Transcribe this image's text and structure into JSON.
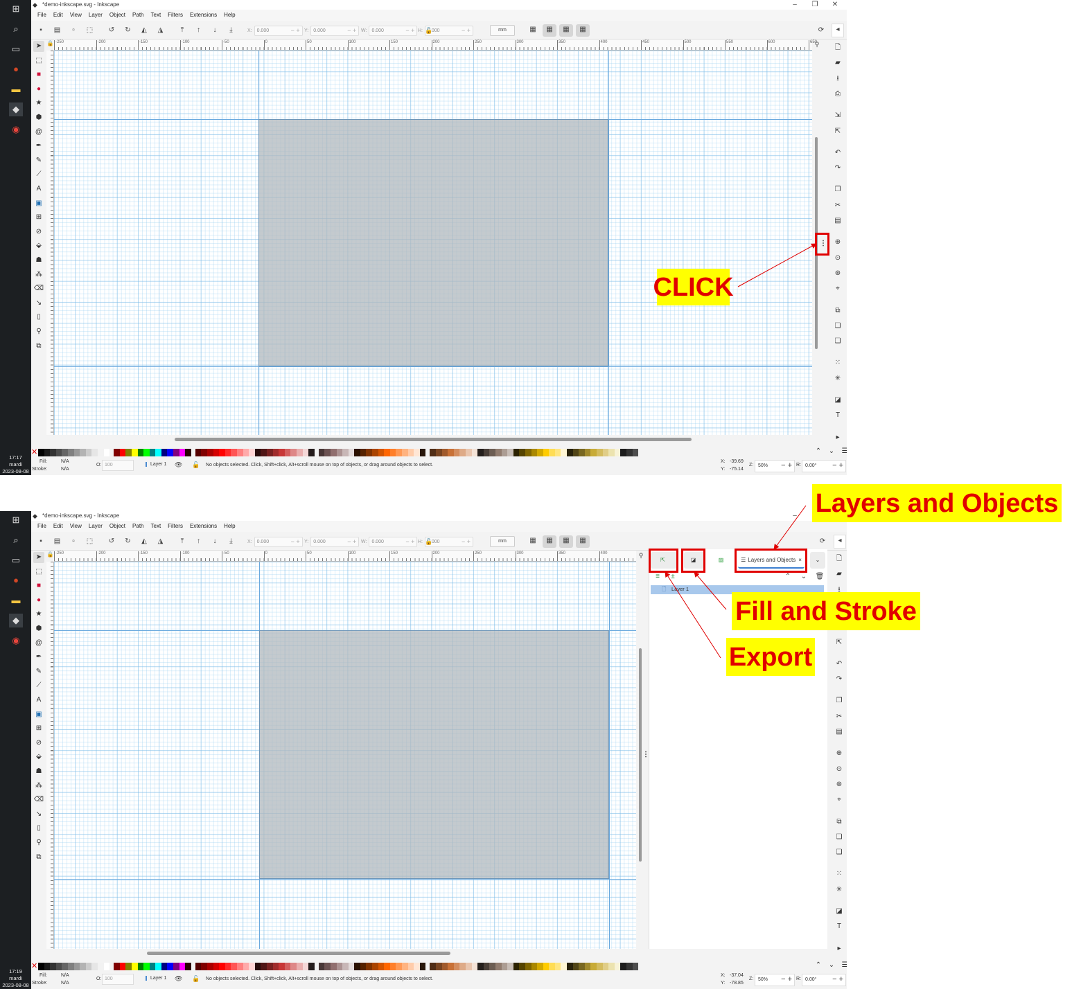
{
  "app": {
    "title": "*demo-inkscape.svg - Inkscape",
    "window_controls": [
      "–",
      "❐",
      "✕"
    ],
    "menu": [
      "File",
      "Edit",
      "View",
      "Layer",
      "Object",
      "Path",
      "Text",
      "Filters",
      "Extensions",
      "Help"
    ],
    "fields": [
      {
        "label": "X:",
        "value": "0.000"
      },
      {
        "label": "Y:",
        "value": "0.000"
      },
      {
        "label": "W:",
        "value": "0.000"
      },
      {
        "label": "H:",
        "value": "0.000"
      }
    ],
    "unit": "mm",
    "taskbar_icons": [
      "windows-icon",
      "search-icon",
      "task-view-icon",
      "powerpoint-icon",
      "file-explorer-icon",
      "inkscape-icon",
      "chrome-icon"
    ],
    "tools": [
      "selector-icon",
      "node-icon",
      "rectangle-icon",
      "ellipse-icon",
      "star-icon",
      "3d-box-icon",
      "spiral-icon",
      "pen-icon",
      "pencil-icon",
      "calligraphy-icon",
      "text-icon",
      "gradient-icon",
      "mesh-icon",
      "dropper-icon",
      "paint-bucket-icon",
      "tweak-icon",
      "spray-icon",
      "eraser-icon",
      "connector-icon",
      "pages-icon",
      "zoom-icon",
      "measure-icon"
    ],
    "commands": [
      "new-document-icon",
      "open-icon",
      "save-icon",
      "print-icon",
      "import-icon",
      "export-icon",
      "undo-icon",
      "redo-icon",
      "copy-icon",
      "cut-icon",
      "paste-icon",
      "zoom-selection-icon",
      "zoom-drawing-icon",
      "zoom-page-icon",
      "zoom-center-icon",
      "duplicate-icon",
      "clone-icon",
      "unlink-clone-icon",
      "group-icon",
      "ungroup-icon",
      "fill-stroke-icon",
      "text-font-icon",
      "more-icon"
    ],
    "palette": [
      "#000000",
      "#1a1a1a",
      "#333333",
      "#4d4d4d",
      "#666666",
      "#808080",
      "#999999",
      "#b3b3b3",
      "#cccccc",
      "#e6e6e6",
      "#f2f2f2",
      "#ffffff",
      "#800000",
      "#ff0000",
      "#808000",
      "#ffff00",
      "#008000",
      "#00ff00",
      "#008080",
      "#00ffff",
      "#000080",
      "#0000ff",
      "#800080",
      "#ff00ff",
      "#2b0000",
      "#550000",
      "#800000",
      "#aa0000",
      "#d40000",
      "#ff0000",
      "#ff2a2a",
      "#ff5555",
      "#ff8080",
      "#ffaaaa",
      "#ffd5d5",
      "#280b0b",
      "#501616",
      "#782121",
      "#a02c2c",
      "#c83737",
      "#d35f5f",
      "#de8787",
      "#e9afaf",
      "#f4d7d7",
      "#241c1c",
      "#483737",
      "#6c5353",
      "#916f6f",
      "#ac9393",
      "#c8b7b7",
      "#e3dbdb",
      "#2b1100",
      "#552200",
      "#803300",
      "#aa4400",
      "#d45500",
      "#ff6600",
      "#ff7f2a",
      "#ff9955",
      "#ffb380",
      "#ffccaa",
      "#ffe6d5",
      "#28170b",
      "#502d16",
      "#784421",
      "#a05a2c",
      "#c87137",
      "#d38d5f",
      "#deaa87",
      "#e9c6af",
      "#f4e3d7",
      "#241f1c",
      "#483e37",
      "#6c5d53",
      "#917c6f",
      "#ac9d93",
      "#c8beb7",
      "#2b2200",
      "#554400",
      "#806600",
      "#aa8800",
      "#d4aa00",
      "#ffcc00",
      "#ffdd55",
      "#ffe680",
      "#fff6d5",
      "#28220b",
      "#504416",
      "#786721",
      "#a0892c",
      "#c8ab37",
      "#d4bc5f",
      "#e0cd87",
      "#ece3af",
      "#f8f3d7",
      "#1c1c1c",
      "#333333",
      "#4d4d4d"
    ],
    "fill_label": "Fill:",
    "stroke_label": "Stroke:",
    "fill_value": "N/A",
    "stroke_value": "N/A",
    "opacity_label": "O:",
    "opacity_value": "100",
    "layer": "Layer 1",
    "status_message": "No objects selected. Click, Shift+click, Alt+scroll mouse on top of objects, or drag around objects to select.",
    "zoom_label": "Z:",
    "zoom": "50%",
    "rotation_label": "R:",
    "rotation": "0.00°",
    "x_label": "X:",
    "y_label": "Y:",
    "colors": {
      "accent": "#e00000",
      "callout_bg": "#ffff00",
      "page_fill": "#b9bfc4",
      "grid": "#9fd0f0",
      "selected_row": "#a8c8ec"
    }
  },
  "screens": [
    {
      "clock": {
        "time": "17:17",
        "day": "mardi",
        "date": "2023-08-08"
      },
      "cursor_x": "-39.69",
      "cursor_y": "-75.14",
      "ruler_labels": [
        "-250",
        "-200",
        "-150",
        "-100",
        "-50",
        "0",
        "50",
        "100",
        "150",
        "200",
        "250",
        "300",
        "350",
        "400",
        "450",
        "500",
        "550",
        "600",
        "650"
      ]
    },
    {
      "clock": {
        "time": "17:19",
        "day": "mardi",
        "date": "2023-08-08"
      },
      "cursor_x": "-37.04",
      "cursor_y": "-78.85",
      "ruler_labels": [
        "-250",
        "-200",
        "-150",
        "-100",
        "-50",
        "0",
        "50",
        "100",
        "150",
        "200",
        "250",
        "300",
        "350",
        "400"
      ],
      "panel": {
        "tabs": [
          {
            "name": "export",
            "icon": "export-icon"
          },
          {
            "name": "fill-and-stroke",
            "icon": "fill-stroke-icon"
          },
          {
            "name": "image",
            "icon": "image-icon"
          },
          {
            "name": "layers-and-objects",
            "label": "Layers and Objects",
            "icon": "layers-icon",
            "active": true
          }
        ],
        "close": "×",
        "layers": [
          "Layer 1"
        ]
      }
    }
  ],
  "annotations": {
    "click": "CLICK",
    "layers_and_objects": "Layers and Objects",
    "fill_and_stroke": "Fill and Stroke",
    "export": "Export"
  }
}
